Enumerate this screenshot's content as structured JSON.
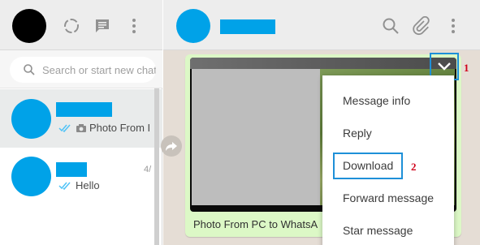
{
  "left": {
    "search": {
      "placeholder": "Search or start new chat"
    },
    "chats": [
      {
        "preview": "Photo From I",
        "time": ""
      },
      {
        "preview": "Hello",
        "time": "4/"
      }
    ]
  },
  "conversation": {
    "caption": "Photo From PC to WhatsA",
    "markers": {
      "first": "1",
      "second": "2"
    },
    "menu": {
      "items": [
        "Message info",
        "Reply",
        "Download",
        "Forward message",
        "Star message"
      ]
    }
  },
  "colors": {
    "accent": "#00a2e8",
    "highlight_outline": "#1e90d8",
    "marker_red": "#d0021b",
    "bubble": "#dcf8c6",
    "chat_background": "#e5ddd5"
  },
  "icons": [
    "status-icon",
    "new-chat-icon",
    "menu-icon",
    "search-icon",
    "attach-icon",
    "double-check-icon",
    "camera-icon",
    "chevron-down-icon",
    "forward-icon"
  ]
}
